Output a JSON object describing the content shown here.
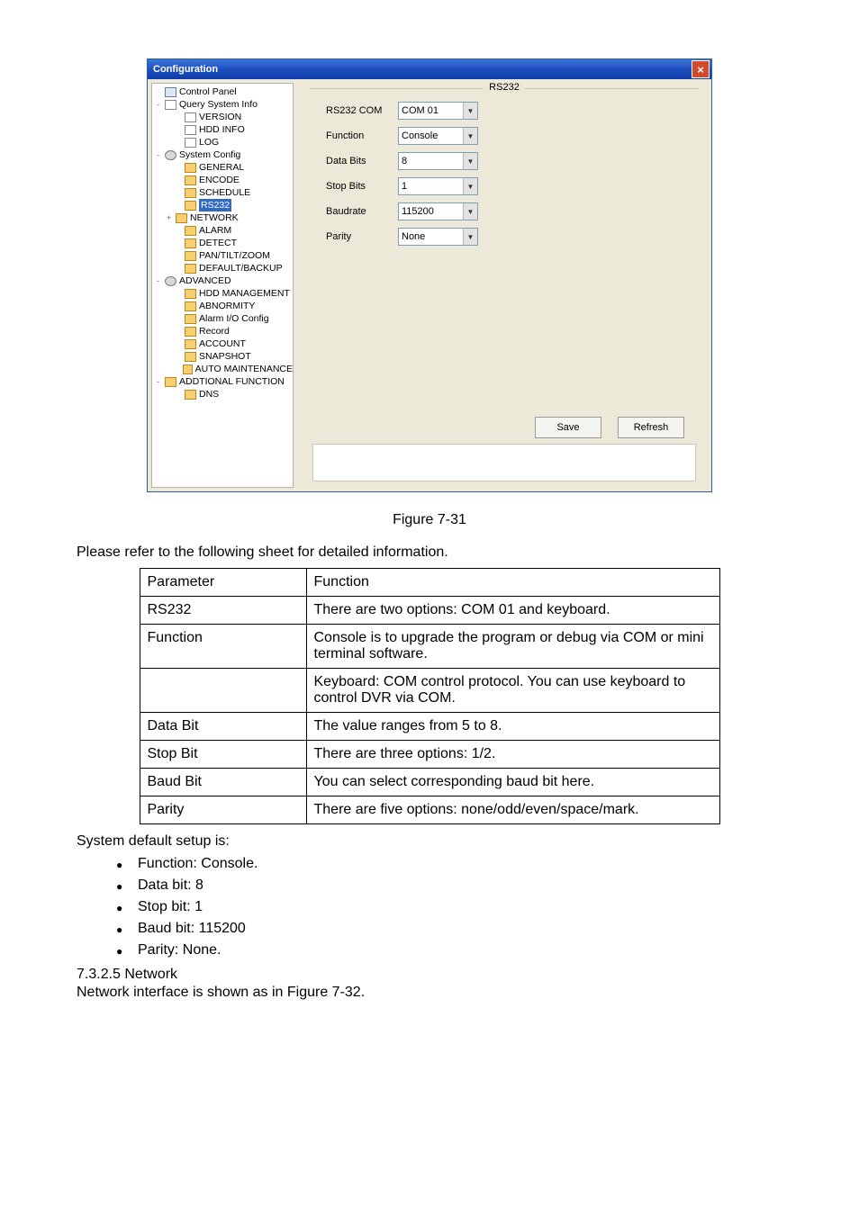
{
  "window": {
    "title": "Configuration",
    "group_title": "RS232",
    "buttons": {
      "save": "Save",
      "refresh": "Refresh"
    },
    "tree": [
      {
        "ex": "",
        "pad": 0,
        "icon": "comp",
        "label": "Control Panel"
      },
      {
        "ex": "-",
        "pad": 0,
        "icon": "doc",
        "label": "Query System Info"
      },
      {
        "ex": "",
        "pad": 22,
        "icon": "doc",
        "label": "VERSION"
      },
      {
        "ex": "",
        "pad": 22,
        "icon": "doc",
        "label": "HDD INFO"
      },
      {
        "ex": "",
        "pad": 22,
        "icon": "doc",
        "label": "LOG"
      },
      {
        "ex": "-",
        "pad": 0,
        "icon": "gear",
        "label": "System Config"
      },
      {
        "ex": "",
        "pad": 22,
        "icon": "folder",
        "label": "GENERAL"
      },
      {
        "ex": "",
        "pad": 22,
        "icon": "folder",
        "label": "ENCODE"
      },
      {
        "ex": "",
        "pad": 22,
        "icon": "folder",
        "label": "SCHEDULE"
      },
      {
        "ex": "",
        "pad": 22,
        "icon": "folder",
        "label": "RS232",
        "sel": true
      },
      {
        "ex": "+",
        "pad": 12,
        "icon": "folder",
        "label": "NETWORK"
      },
      {
        "ex": "",
        "pad": 22,
        "icon": "folder",
        "label": "ALARM"
      },
      {
        "ex": "",
        "pad": 22,
        "icon": "folder",
        "label": "DETECT"
      },
      {
        "ex": "",
        "pad": 22,
        "icon": "folder",
        "label": "PAN/TILT/ZOOM"
      },
      {
        "ex": "",
        "pad": 22,
        "icon": "folder",
        "label": "DEFAULT/BACKUP"
      },
      {
        "ex": "-",
        "pad": 0,
        "icon": "gear",
        "label": "ADVANCED"
      },
      {
        "ex": "",
        "pad": 22,
        "icon": "folder",
        "label": "HDD MANAGEMENT"
      },
      {
        "ex": "",
        "pad": 22,
        "icon": "folder",
        "label": "ABNORMITY"
      },
      {
        "ex": "",
        "pad": 22,
        "icon": "folder",
        "label": "Alarm I/O Config"
      },
      {
        "ex": "",
        "pad": 22,
        "icon": "folder",
        "label": "Record"
      },
      {
        "ex": "",
        "pad": 22,
        "icon": "folder",
        "label": "ACCOUNT"
      },
      {
        "ex": "",
        "pad": 22,
        "icon": "folder",
        "label": "SNAPSHOT"
      },
      {
        "ex": "",
        "pad": 22,
        "icon": "folder",
        "label": "AUTO MAINTENANCE"
      },
      {
        "ex": "-",
        "pad": 0,
        "icon": "folder",
        "label": "ADDTIONAL FUNCTION"
      },
      {
        "ex": "",
        "pad": 22,
        "icon": "folder",
        "label": "DNS"
      }
    ],
    "fields": [
      {
        "label": "RS232 COM",
        "value": "COM 01"
      },
      {
        "label": "Function",
        "value": "Console"
      },
      {
        "label": "Data Bits",
        "value": "8"
      },
      {
        "label": "Stop Bits",
        "value": "1"
      },
      {
        "label": "Baudrate",
        "value": "115200"
      },
      {
        "label": "Parity",
        "value": "None"
      }
    ]
  },
  "caption": "Figure 7-31",
  "lead": "Please refer to the following sheet for detailed information.",
  "table": {
    "head": {
      "p": "Parameter",
      "f": "Function"
    },
    "rows": [
      {
        "p": "RS232",
        "f": "There are two options: COM 01 and keyboard."
      },
      {
        "p": "Function",
        "f": "Console is to upgrade the program or debug via COM or mini terminal software."
      },
      {
        "p": "",
        "f": "Keyboard: COM control protocol. You can use keyboard to control DVR via COM.",
        "merge": true
      },
      {
        "p": "Data Bit",
        "f": "The value ranges from 5 to 8."
      },
      {
        "p": "Stop Bit",
        "f": "There are three options: 1/2."
      },
      {
        "p": "Baud Bit",
        "f": "You can select corresponding baud bit here."
      },
      {
        "p": "Parity",
        "f": "There are five options: none/odd/even/space/mark."
      }
    ]
  },
  "trailer": {
    "lead": "System default setup is:",
    "bullets": [
      "Function: Console.",
      "Data bit: 8",
      "Stop bit: 1",
      "Baud bit: 115200",
      "Parity: None."
    ],
    "subhead": "7.3.2.5  Network",
    "subtext": "Network interface is shown as in Figure 7-32."
  }
}
